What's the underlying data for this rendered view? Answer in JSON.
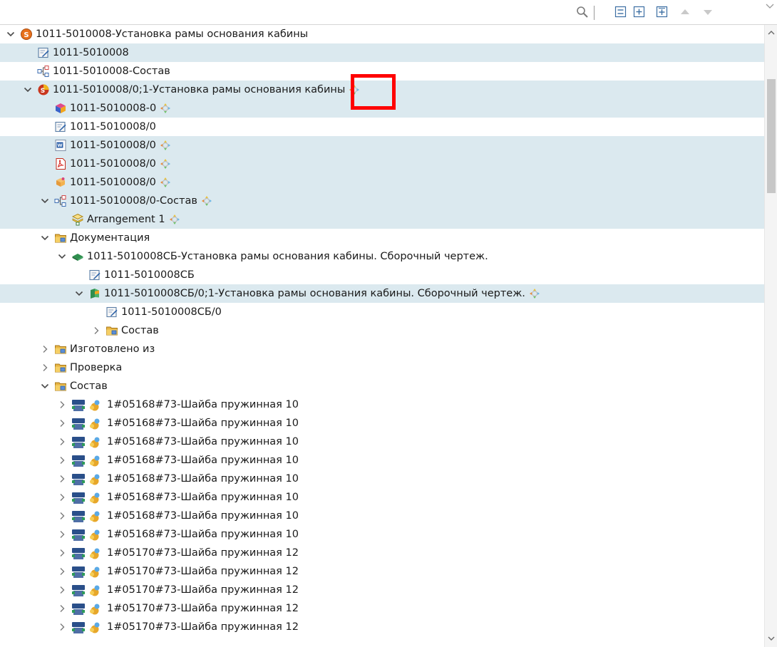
{
  "toolbar": {
    "buttons": [
      "search-icon",
      "collapse-all-icon",
      "expand-icon",
      "expand-all-icon",
      "move-up-icon",
      "move-down-icon"
    ]
  },
  "tree": [
    {
      "text": "1011-5010008-Установка рамы основания кабины",
      "level": 0,
      "twisty": "expanded",
      "icon": "product-s-icon",
      "status": false,
      "highlight": false
    },
    {
      "text": "1011-5010008",
      "level": 1,
      "twisty": "none",
      "icon": "form-icon",
      "status": false,
      "highlight": true
    },
    {
      "text": "1011-5010008-Состав",
      "level": 1,
      "twisty": "none",
      "icon": "structure-icon",
      "status": false,
      "highlight": false
    },
    {
      "text": "1011-5010008/0;1-Установка рамы основания кабины",
      "level": 1,
      "twisty": "expanded",
      "icon": "revision-icon",
      "status": true,
      "highlight": true
    },
    {
      "text": "1011-5010008-0",
      "level": 2,
      "twisty": "none",
      "icon": "model-3d-icon",
      "status": true,
      "highlight": true
    },
    {
      "text": "1011-5010008/0",
      "level": 2,
      "twisty": "none",
      "icon": "form-icon",
      "status": false,
      "highlight": false
    },
    {
      "text": "1011-5010008/0",
      "level": 2,
      "twisty": "none",
      "icon": "word-doc-icon",
      "status": true,
      "highlight": true
    },
    {
      "text": "1011-5010008/0",
      "level": 2,
      "twisty": "none",
      "icon": "pdf-icon",
      "status": true,
      "highlight": true
    },
    {
      "text": "1011-5010008/0",
      "level": 2,
      "twisty": "none",
      "icon": "dataset-icon",
      "status": true,
      "highlight": true
    },
    {
      "text": "1011-5010008/0-Состав",
      "level": 2,
      "twisty": "expanded",
      "icon": "structure-icon",
      "status": true,
      "highlight": true
    },
    {
      "text": "Arrangement 1",
      "level": 3,
      "twisty": "none",
      "icon": "arrangement-icon",
      "status": true,
      "highlight": true
    },
    {
      "text": "Документация",
      "level": 2,
      "twisty": "expanded",
      "icon": "folder-icon",
      "status": false,
      "highlight": false
    },
    {
      "text": "1011-5010008СБ-Установка рамы основания кабины. Сборочный чертеж.",
      "level": 3,
      "twisty": "expanded",
      "icon": "drawing-item-icon",
      "status": false,
      "highlight": false
    },
    {
      "text": "1011-5010008СБ",
      "level": 4,
      "twisty": "none",
      "icon": "form-icon",
      "status": false,
      "highlight": false
    },
    {
      "text": "1011-5010008СБ/0;1-Установка рамы основания кабины. Сборочный чертеж.",
      "level": 4,
      "twisty": "expanded",
      "icon": "drawing-revision-icon",
      "status": true,
      "highlight": true
    },
    {
      "text": "1011-5010008СБ/0",
      "level": 5,
      "twisty": "none",
      "icon": "form-icon",
      "status": false,
      "highlight": false
    },
    {
      "text": "Состав",
      "level": 5,
      "twisty": "collapsed",
      "icon": "folder-icon",
      "status": false,
      "highlight": false
    },
    {
      "text": "Изготовлено из",
      "level": 2,
      "twisty": "collapsed",
      "icon": "folder-icon",
      "status": false,
      "highlight": false
    },
    {
      "text": "Проверка",
      "level": 2,
      "twisty": "collapsed",
      "icon": "folder-icon",
      "status": false,
      "highlight": false
    },
    {
      "text": "Состав",
      "level": 2,
      "twisty": "expanded",
      "icon": "folder-icon",
      "status": false,
      "highlight": false
    },
    {
      "text": "1#05168#73-Шайба пружинная 10",
      "level": 3,
      "twisty": "collapsed",
      "icon": "bom-line-icon",
      "status": false,
      "highlight": false
    },
    {
      "text": "1#05168#73-Шайба пружинная 10",
      "level": 3,
      "twisty": "collapsed",
      "icon": "bom-line-icon",
      "status": false,
      "highlight": false
    },
    {
      "text": "1#05168#73-Шайба пружинная 10",
      "level": 3,
      "twisty": "collapsed",
      "icon": "bom-line-icon",
      "status": false,
      "highlight": false
    },
    {
      "text": "1#05168#73-Шайба пружинная 10",
      "level": 3,
      "twisty": "collapsed",
      "icon": "bom-line-icon",
      "status": false,
      "highlight": false
    },
    {
      "text": "1#05168#73-Шайба пружинная 10",
      "level": 3,
      "twisty": "collapsed",
      "icon": "bom-line-icon",
      "status": false,
      "highlight": false
    },
    {
      "text": "1#05168#73-Шайба пружинная 10",
      "level": 3,
      "twisty": "collapsed",
      "icon": "bom-line-icon",
      "status": false,
      "highlight": false
    },
    {
      "text": "1#05168#73-Шайба пружинная 10",
      "level": 3,
      "twisty": "collapsed",
      "icon": "bom-line-icon",
      "status": false,
      "highlight": false
    },
    {
      "text": "1#05168#73-Шайба пружинная 10",
      "level": 3,
      "twisty": "collapsed",
      "icon": "bom-line-icon",
      "status": false,
      "highlight": false
    },
    {
      "text": "1#05170#73-Шайба пружинная 12",
      "level": 3,
      "twisty": "collapsed",
      "icon": "bom-line-icon",
      "status": false,
      "highlight": false
    },
    {
      "text": "1#05170#73-Шайба пружинная 12",
      "level": 3,
      "twisty": "collapsed",
      "icon": "bom-line-icon",
      "status": false,
      "highlight": false
    },
    {
      "text": "1#05170#73-Шайба пружинная 12",
      "level": 3,
      "twisty": "collapsed",
      "icon": "bom-line-icon",
      "status": false,
      "highlight": false
    },
    {
      "text": "1#05170#73-Шайба пружинная 12",
      "level": 3,
      "twisty": "collapsed",
      "icon": "bom-line-icon",
      "status": false,
      "highlight": false
    },
    {
      "text": "1#05170#73-Шайба пружинная 12",
      "level": 3,
      "twisty": "collapsed",
      "icon": "bom-line-icon",
      "status": false,
      "highlight": false
    }
  ]
}
